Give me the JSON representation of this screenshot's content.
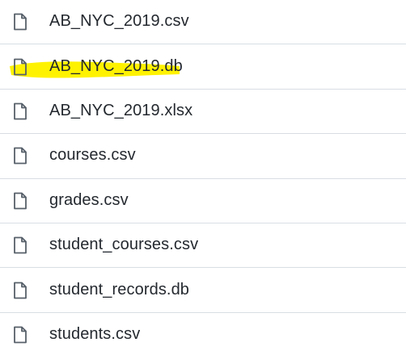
{
  "files": [
    {
      "name": "AB_NYC_2019.csv",
      "icon": "file-icon"
    },
    {
      "name": "AB_NYC_2019.db",
      "icon": "file-icon",
      "highlighted": true,
      "highlight_color": "#fff200"
    },
    {
      "name": "AB_NYC_2019.xlsx",
      "icon": "file-icon"
    },
    {
      "name": "courses.csv",
      "icon": "file-icon"
    },
    {
      "name": "grades.csv",
      "icon": "file-icon"
    },
    {
      "name": "student_courses.csv",
      "icon": "file-icon"
    },
    {
      "name": "student_records.db",
      "icon": "file-icon"
    },
    {
      "name": "students.csv",
      "icon": "file-icon"
    }
  ],
  "colors": {
    "text": "#24292f",
    "icon": "#57606a",
    "divider": "#d8dee4",
    "highlight": "#fff200"
  }
}
